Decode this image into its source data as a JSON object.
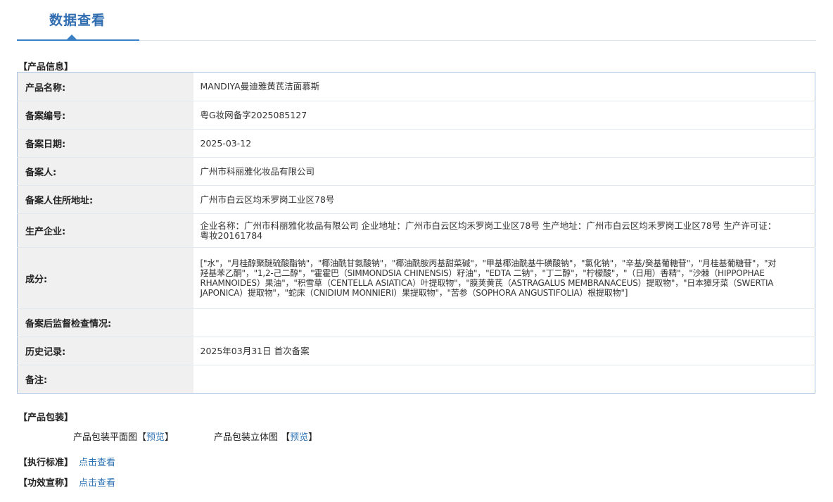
{
  "page": {
    "tab_title": "数据查看"
  },
  "product_info": {
    "section_title": "【产品信息】",
    "rows": [
      {
        "label": "产品名称:",
        "value": "MANDIYA曼迪雅黄芪洁面慕斯"
      },
      {
        "label": "备案编号:",
        "value": "粤G妆网备字2025085127"
      },
      {
        "label": "备案日期:",
        "value": "2025-03-12"
      },
      {
        "label": "备案人:",
        "value": "广州市科丽雅化妆品有限公司"
      },
      {
        "label": "备案人住所地址:",
        "value": "广州市白云区均禾罗岗工业区78号"
      },
      {
        "label": "生产企业:",
        "value": "企业名称：广州市科丽雅化妆品有限公司 企业地址：广州市白云区均禾罗岗工业区78号 生产地址：广州市白云区均禾罗岗工业区78号 生产许可证：粤妆20161784"
      },
      {
        "label": "成分:",
        "value": "[\"水\"，\"月桂醇聚醚硫酸酯钠\"，\"椰油酰甘氨酸钠\"，\"椰油酰胺丙基甜菜碱\"，\"甲基椰油酰基牛磺酸钠\"，\"氯化钠\"，\"辛基/癸基葡糖苷\"，\"月桂基葡糖苷\"，\"对羟基苯乙酮\"，\"1,2-己二醇\"，\"霍霍巴（SIMMONDSIA CHINENSIS）籽油\"，\"EDTA 二钠\"，\"丁二醇\"，\"柠檬酸\"，\"（日用）香精\"，\"沙棘（HIPPOPHAE RHAMNOIDES）果油\"，\"积雪草（CENTELLA ASIATICA）叶提取物\"，\"膜荚黄芪（ASTRAGALUS MEMBRANACEUS）提取物\"，\"日本獐牙菜（SWERTIA JAPONICA）提取物\"，\"蛇床（CNIDIUM MONNIERI）果提取物\"，\"苦参（SOPHORA ANGUSTIFOLIA）根提取物\"]"
      },
      {
        "label": "备案后监督检查情况:",
        "value": ""
      },
      {
        "label": "历史记录:",
        "value": "2025年03月31日 首次备案"
      },
      {
        "label": "备注:",
        "value": ""
      }
    ]
  },
  "packaging": {
    "section_title": "【产品包装】",
    "flat_label": "产品包装平面图",
    "flat_link": "预览",
    "solid_label": "产品包装立体图",
    "solid_link": "预览",
    "bracket_open": "【",
    "bracket_close": "】"
  },
  "standard": {
    "label": "【执行标准】",
    "link": "点击查看"
  },
  "efficacy": {
    "label": "【功效宣称】",
    "link": "点击查看"
  }
}
